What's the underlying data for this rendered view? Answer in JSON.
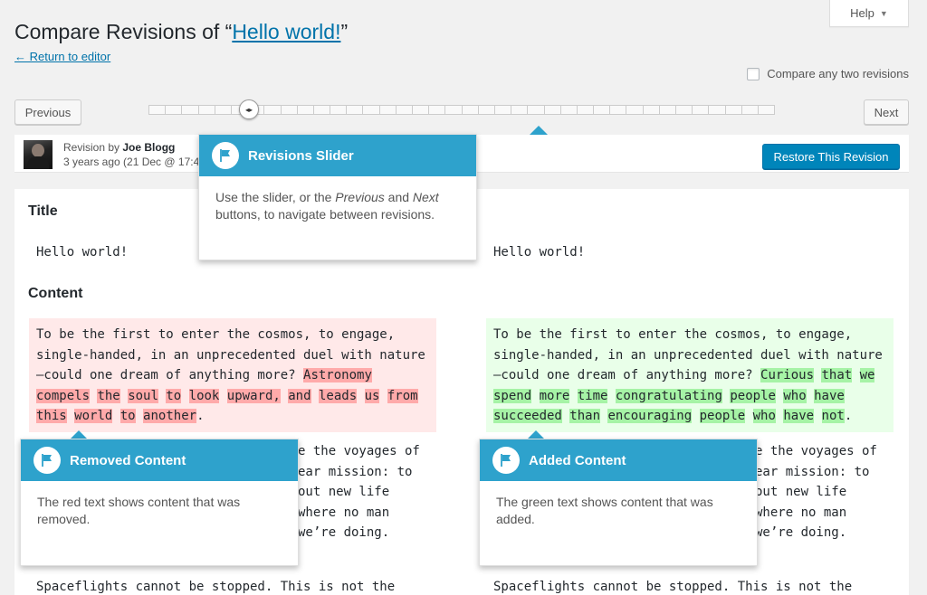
{
  "help": {
    "label": "Help",
    "caret": "▼"
  },
  "page": {
    "title_prefix": "Compare Revisions of “",
    "title_link": "Hello world!",
    "title_suffix": "”",
    "return_link": "← Return to editor"
  },
  "compare_any": {
    "label": "Compare any two revisions"
  },
  "nav": {
    "previous": "Previous",
    "next": "Next",
    "handle_glyph": "◂▸"
  },
  "revision": {
    "by_prefix": "Revision by ",
    "author": "Joe Blogg",
    "date": "3 years ago (21 Dec @ 17:4",
    "restore_label": "Restore This Revision"
  },
  "diff": {
    "title_heading": "Title",
    "content_heading": "Content",
    "left_title": "Hello world!",
    "right_title": "Hello world!",
    "left_line1": "To be the first to enter the cosmos, to engage,",
    "left_line2": "single-handed, in an unprecedented duel with nature",
    "left_line3_plain": "—could one dream of anything more? ",
    "left_line3_del": "Astronomy",
    "left_line4": [
      "compels",
      "the",
      "soul",
      "to",
      "look",
      "upward,",
      "and",
      "leads",
      "us",
      "from"
    ],
    "left_line5": [
      "this",
      "world",
      "to",
      "another"
    ],
    "left_line5_end": ".",
    "right_line1": "To be the first to enter the cosmos, to engage,",
    "right_line2": "single-handed, in an unprecedented duel with nature",
    "right_line3_plain": "—could one dream of anything more? ",
    "right_line3_ins": [
      "Curious",
      "that",
      "we"
    ],
    "right_line4": [
      "spend",
      "more",
      "time",
      "congratulating",
      "people",
      "who",
      "have"
    ],
    "right_line5": [
      "succeeded",
      "than",
      "encouraging",
      "people",
      "who",
      "have",
      "not"
    ],
    "right_line5_end": ".",
    "left_p2_l1": "e the voyages of",
    "left_p2_l2": "ear mission: to",
    "left_p2_l3": "out new life",
    "left_p2_l4": "where no man",
    "left_p2_l5": "we’re doing.",
    "right_p2_l1": "e the voyages of",
    "right_p2_l2": "ear mission: to",
    "right_p2_l3": "out new life",
    "right_p2_l4": "where no man",
    "right_p2_l5": "we’re doing.",
    "left_p3": "Spaceflights cannot be stopped. This is not the",
    "right_p3": "Spaceflights cannot be stopped. This is not the"
  },
  "pointers": {
    "slider": {
      "title": "Revisions Slider",
      "body_1": "Use the slider, or the ",
      "body_em1": "Previous",
      "body_2": " and ",
      "body_em2": "Next",
      "body_3": " buttons, to navigate between revisions."
    },
    "removed": {
      "title": "Removed Content",
      "body": "The red text shows content that was removed."
    },
    "added": {
      "title": "Added Content",
      "body": "The green text shows content that was added."
    }
  },
  "colors": {
    "accent": "#2ea2cc",
    "primary_button": "#0085ba",
    "link": "#0073aa",
    "removed_bg": "#ffe9e9",
    "removed_mark": "#ffaaaa",
    "added_bg": "#e9ffe9",
    "added_mark": "#a6f3a6"
  }
}
